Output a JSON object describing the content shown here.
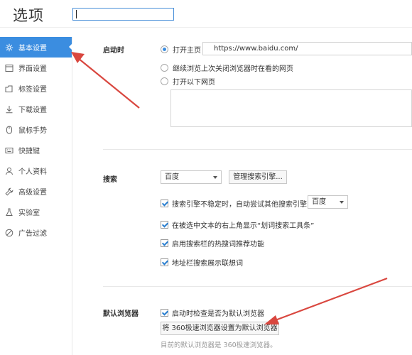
{
  "window": {
    "title": "选项"
  },
  "search": {
    "value": ""
  },
  "sidebar": {
    "items": [
      {
        "label": "基本设置",
        "icon": "gear-icon",
        "active": true
      },
      {
        "label": "界面设置",
        "icon": "window-icon"
      },
      {
        "label": "标签设置",
        "icon": "tab-icon"
      },
      {
        "label": "下载设置",
        "icon": "download-icon"
      },
      {
        "label": "鼠标手势",
        "icon": "mouse-icon"
      },
      {
        "label": "快捷键",
        "icon": "keyboard-icon"
      },
      {
        "label": "个人资料",
        "icon": "user-icon"
      },
      {
        "label": "高级设置",
        "icon": "wrench-icon"
      },
      {
        "label": "实验室",
        "icon": "flask-icon"
      },
      {
        "label": "广告过滤",
        "icon": "block-icon"
      }
    ]
  },
  "startup": {
    "label": "启动时",
    "option_home": "打开主页",
    "home_url": "https://www.baidu.com/",
    "option_restore": "继续浏览上次关闭浏览器时在看的网页",
    "option_pages": "打开以下网页"
  },
  "search_section": {
    "label": "搜索",
    "engine": "百度",
    "manage_button": "管理搜索引擎...",
    "fallback_text": "搜索引擎不稳定时，自动尝试其他搜索引擎：",
    "fallback_engine": "百度",
    "option_selection_toolbar": "在被选中文本的右上角显示“划词搜索工具条”",
    "option_hot_search": "启用搜索栏的热搜词推荐功能",
    "option_address_suggest": "地址栏搜索展示联想词"
  },
  "default_browser": {
    "label": "默认浏览器",
    "check_on_start": "启动时检查是否为默认浏览器",
    "set_button": "将 360极速浏览器设置为默认浏览器",
    "status": "目前的默认浏览器是 360极速浏览器。"
  },
  "colors": {
    "accent": "#3b8de0",
    "annotation": "#d9473f"
  }
}
